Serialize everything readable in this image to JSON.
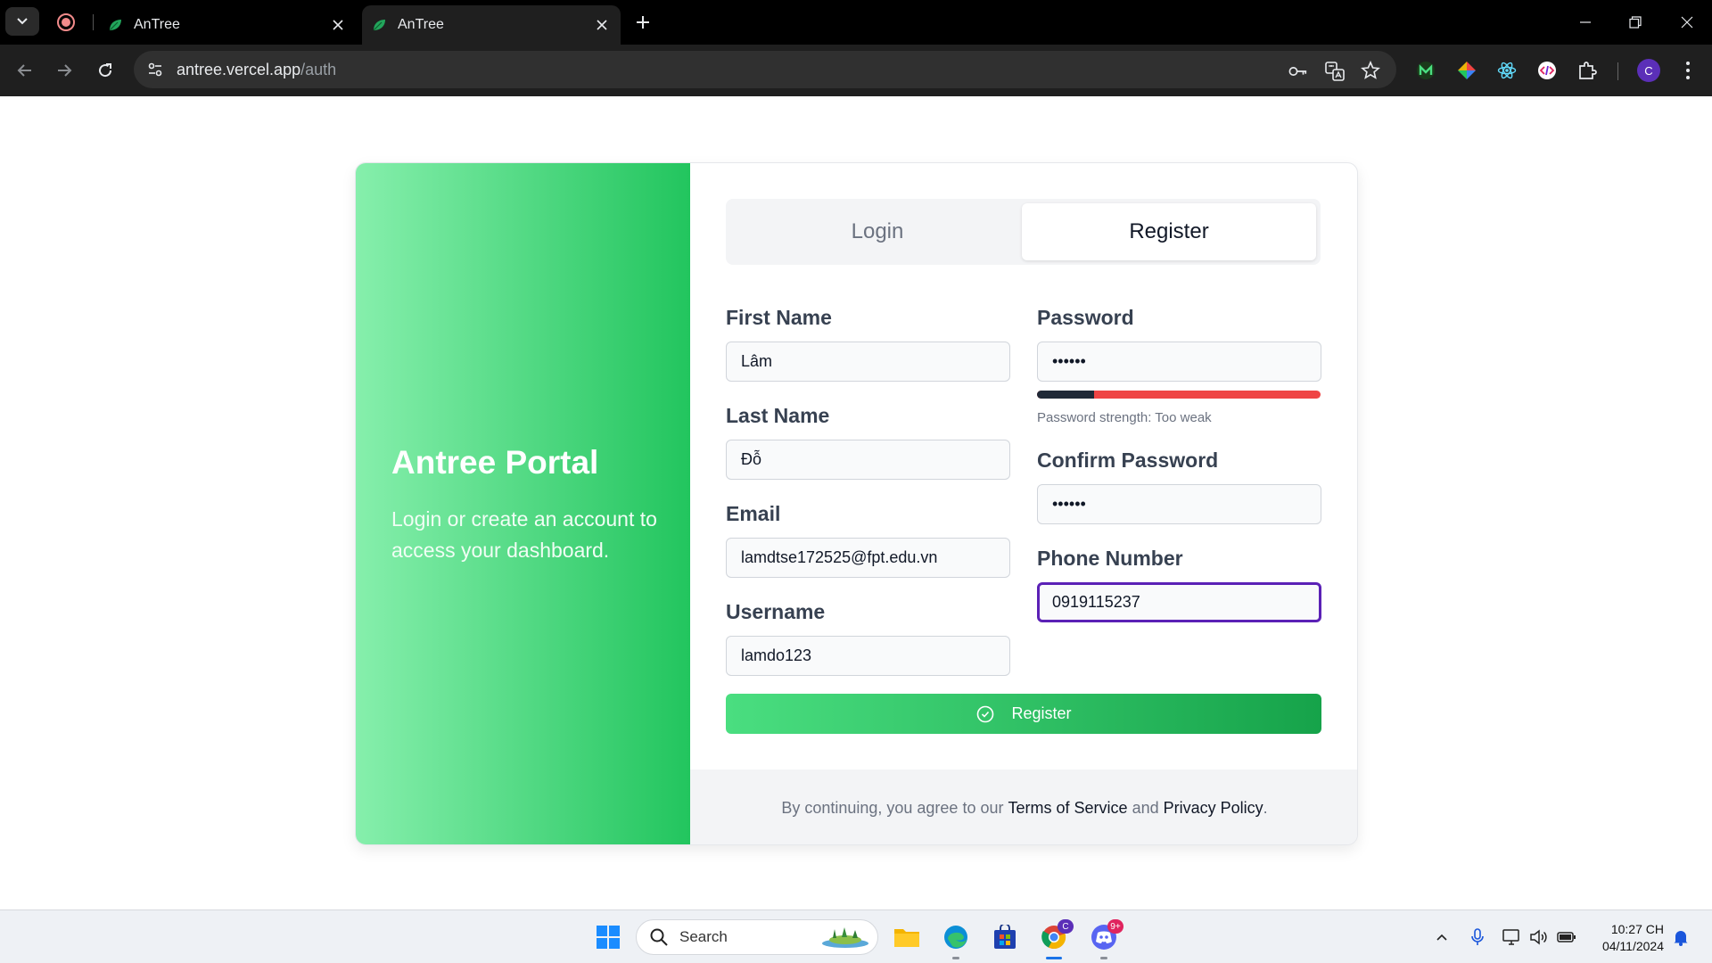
{
  "browser": {
    "tabs": [
      {
        "title": "AnTree"
      },
      {
        "title": "AnTree"
      }
    ],
    "url_host": "antree.vercel.app",
    "url_path": "/auth"
  },
  "hero": {
    "title": "Antree Portal",
    "subtitle": "Login or create an account to access your dashboard."
  },
  "auth_tabs": {
    "login": "Login",
    "register": "Register"
  },
  "form": {
    "first_name": {
      "label": "First Name",
      "value": "Lâm"
    },
    "last_name": {
      "label": "Last Name",
      "value": "Đỗ"
    },
    "email": {
      "label": "Email",
      "value": "lamdtse172525@fpt.edu.vn"
    },
    "username": {
      "label": "Username",
      "value": "lamdo123"
    },
    "password": {
      "label": "Password",
      "value": "••••••",
      "strength_text": "Password strength: Too weak",
      "strength_level": 0.2
    },
    "confirm_password": {
      "label": "Confirm Password",
      "value": "••••••"
    },
    "phone": {
      "label": "Phone Number",
      "value": "0919115237"
    },
    "submit_label": "Register"
  },
  "footer": {
    "prefix": "By continuing, you agree to our",
    "terms": "Terms of Service",
    "and": "and",
    "privacy": "Privacy Policy",
    "suffix": "."
  },
  "taskbar": {
    "search_placeholder": "Search",
    "discord_badge": "9+",
    "chrome_badge": "C",
    "time": "10:27 CH",
    "date": "04/11/2024"
  },
  "colors": {
    "brand_green": "#22c55e",
    "focus_ring": "#5b21b6",
    "strength_weak": "#ef4444"
  }
}
